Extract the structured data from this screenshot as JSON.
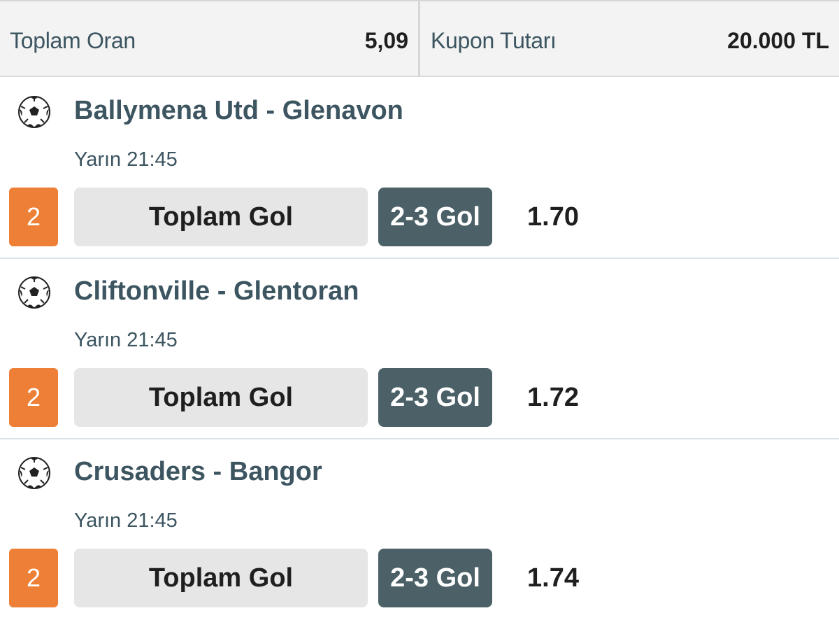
{
  "header": {
    "total_odds_label": "Toplam Oran",
    "total_odds_value": "5,09",
    "stake_label": "Kupon Tutarı",
    "stake_value": "20.000 TL"
  },
  "matches": [
    {
      "teams": "Ballymena Utd - Glenavon",
      "time": "Yarın 21:45",
      "pick_number": "2",
      "market": "Toplam Gol",
      "selection": "2-3 Gol",
      "odds": "1.70",
      "icon": "soccer-ball-icon"
    },
    {
      "teams": "Cliftonville - Glentoran",
      "time": "Yarın 21:45",
      "pick_number": "2",
      "market": "Toplam Gol",
      "selection": "2-3 Gol",
      "odds": "1.72",
      "icon": "soccer-ball-icon"
    },
    {
      "teams": "Crusaders - Bangor",
      "time": "Yarın 21:45",
      "pick_number": "2",
      "market": "Toplam Gol",
      "selection": "2-3 Gol",
      "odds": "1.74",
      "icon": "soccer-ball-icon"
    }
  ],
  "colors": {
    "accent_orange": "#ee7f36",
    "selection_bg": "#4b6167",
    "team_text": "#3c5560"
  }
}
